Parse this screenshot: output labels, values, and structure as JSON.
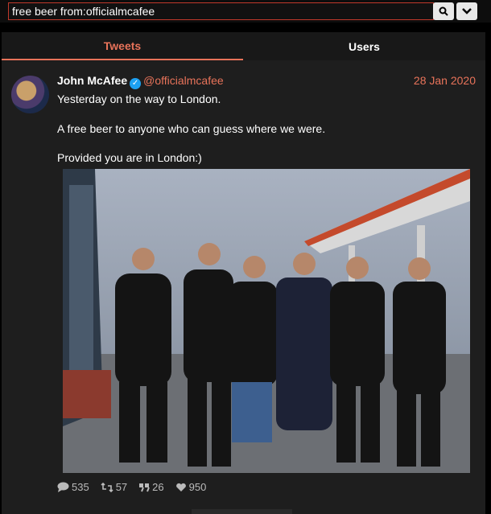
{
  "search": {
    "query": "free beer from:officialmcafee",
    "search_icon": "search-icon",
    "menu_icon": "chevron-down-icon"
  },
  "tabs": [
    {
      "label": "Tweets",
      "active": true
    },
    {
      "label": "Users",
      "active": false
    }
  ],
  "tweet": {
    "name": "John McAfee",
    "handle": "@officialmcafee",
    "date": "28 Jan 2020",
    "lines": [
      "Yesterday on the way to London.",
      "A free beer to anyone who can guess where we were.",
      "Provided you are in London:)"
    ],
    "stats": {
      "replies": "535",
      "retweets": "57",
      "quotes": "26",
      "likes": "950"
    }
  },
  "colors": {
    "accent": "#e8735a",
    "border": "#c0392b",
    "verified": "#1da1f2"
  }
}
